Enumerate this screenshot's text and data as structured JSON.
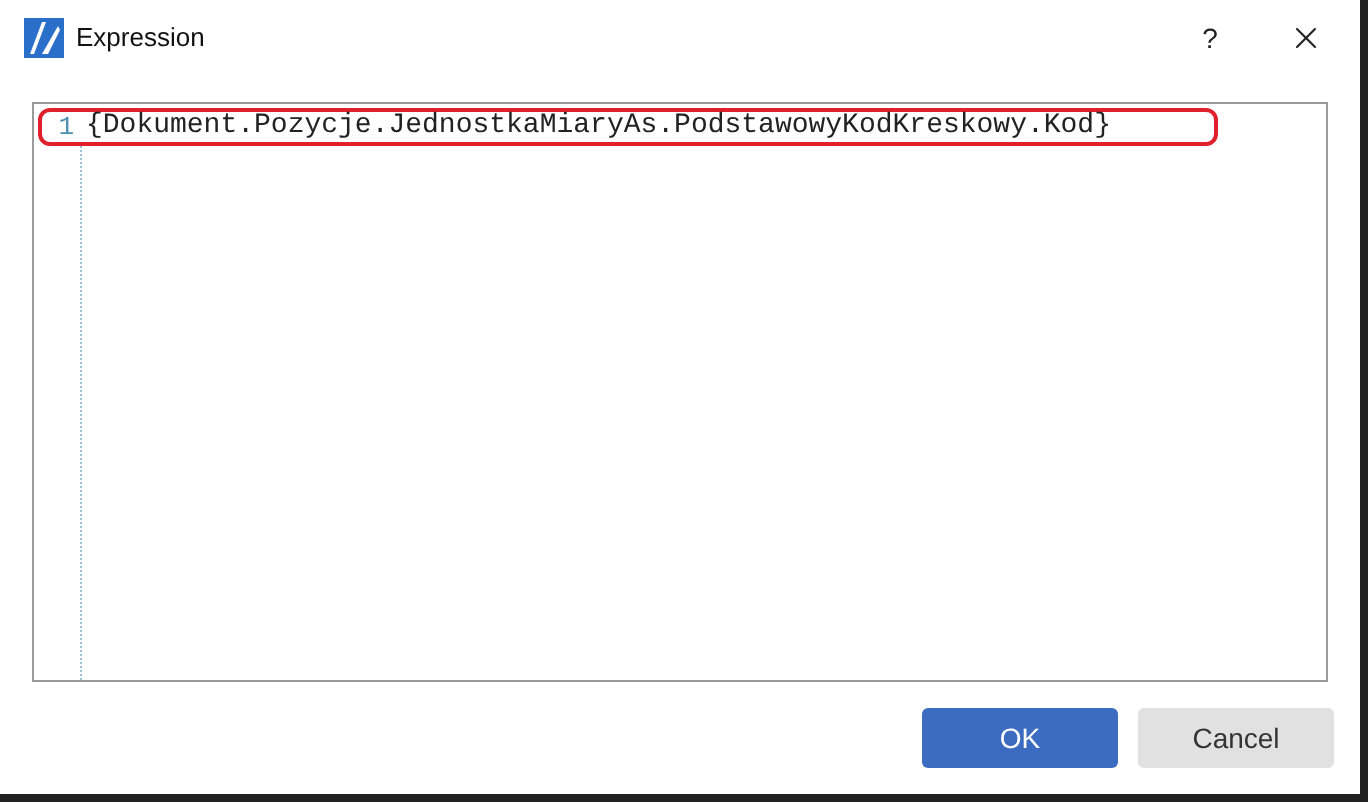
{
  "window": {
    "title": "Expression",
    "help": "?"
  },
  "editor": {
    "lines": [
      {
        "number": "1",
        "text": "{Dokument.Pozycje.JednostkaMiaryAs.PodstawowyKodKreskowy.Kod}",
        "highlighted": true
      }
    ]
  },
  "buttons": [
    {
      "label": "OK",
      "kind": "primary"
    },
    {
      "label": "Cancel",
      "kind": "secondary"
    }
  ]
}
